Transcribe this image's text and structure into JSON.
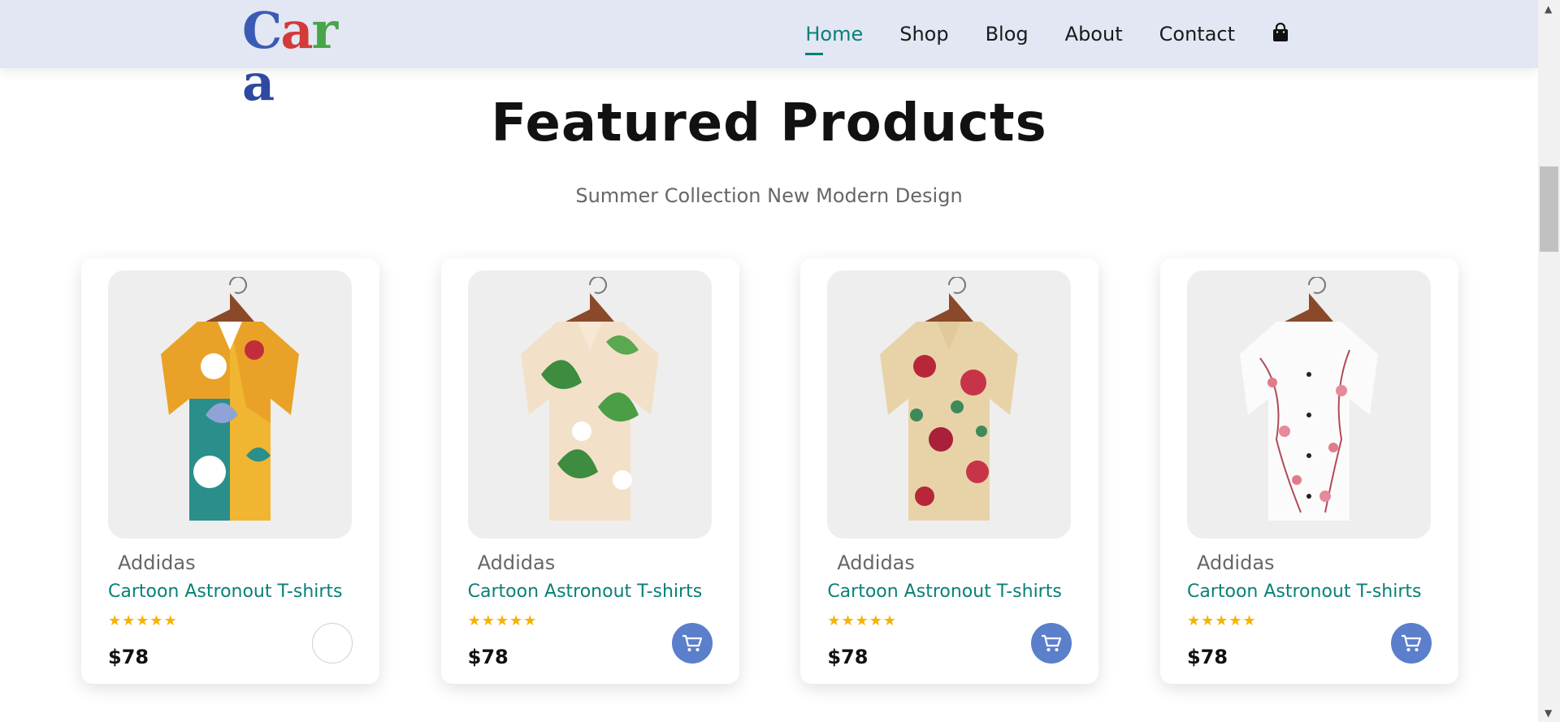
{
  "header": {
    "logo_text": "Cara",
    "nav": [
      "Home",
      "Shop",
      "Blog",
      "About",
      "Contact"
    ],
    "active_nav": "Home",
    "cart_icon": "shopping-bag-icon"
  },
  "section": {
    "title": "Featured Products",
    "subtitle": "Summer Collection New Modern Design"
  },
  "products": [
    {
      "brand": "Addidas",
      "name": "Cartoon Astronout T-shirts",
      "rating": 5,
      "price": "$78",
      "cart_icon": "cart-icon"
    },
    {
      "brand": "Addidas",
      "name": "Cartoon Astronout T-shirts",
      "rating": 5,
      "price": "$78",
      "cart_icon": "cart-icon"
    },
    {
      "brand": "Addidas",
      "name": "Cartoon Astronout T-shirts",
      "rating": 5,
      "price": "$78",
      "cart_icon": "cart-icon"
    },
    {
      "brand": "Addidas",
      "name": "Cartoon Astronout T-shirts",
      "rating": 5,
      "price": "$78",
      "cart_icon": "cart-icon"
    }
  ],
  "colors": {
    "accent": "#088178",
    "header_bg": "#e3e6f3",
    "cart_button": "#5c7fcb",
    "star": "#f5b301"
  }
}
